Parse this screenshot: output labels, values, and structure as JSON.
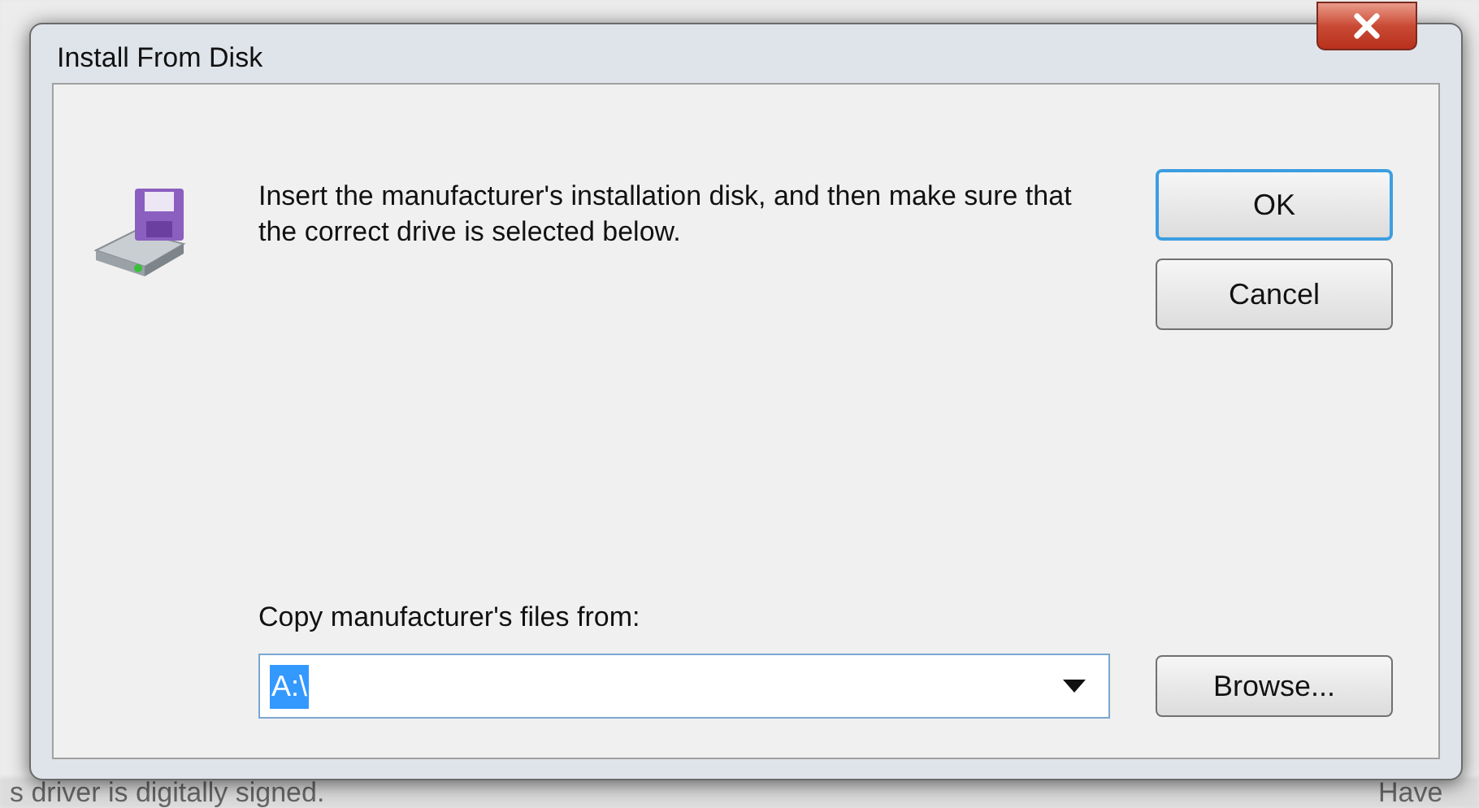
{
  "background": {
    "status_text": "s driver is digitally signed.",
    "button_text": "Have"
  },
  "dialog": {
    "title": "Install From Disk",
    "message": "Insert the manufacturer's installation disk, and then make sure that the correct drive is selected below.",
    "buttons": [
      {
        "label": "OK",
        "default": true
      },
      {
        "label": "Cancel",
        "default": false
      }
    ],
    "source": {
      "label": "Copy manufacturer's files from:",
      "value": "A:\\",
      "value_selected": true,
      "browse": "Browse..."
    }
  }
}
